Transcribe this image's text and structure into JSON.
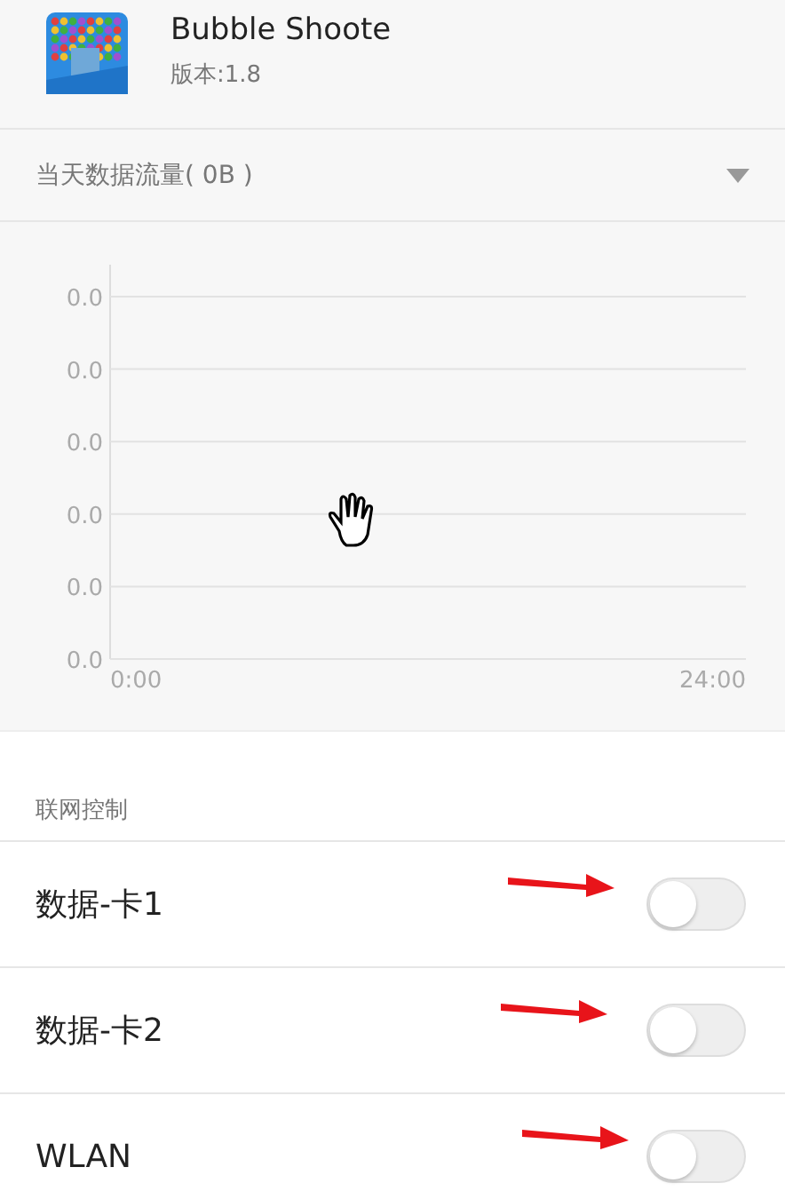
{
  "app": {
    "name": "Bubble Shoote",
    "version": "版本:1.8"
  },
  "usage": {
    "label": "当天数据流量( 0B )",
    "expanded": false
  },
  "chart": {
    "x_labels": [
      "0:00",
      "24:00"
    ],
    "y_labels": [
      "0.0",
      "0.0",
      "0.0",
      "0.0",
      "0.0",
      "0.0"
    ]
  },
  "network": {
    "title": "联网控制",
    "items": [
      {
        "label": "数据-卡1",
        "on": false
      },
      {
        "label": "数据-卡2",
        "on": false
      },
      {
        "label": "WLAN",
        "on": false
      }
    ]
  }
}
